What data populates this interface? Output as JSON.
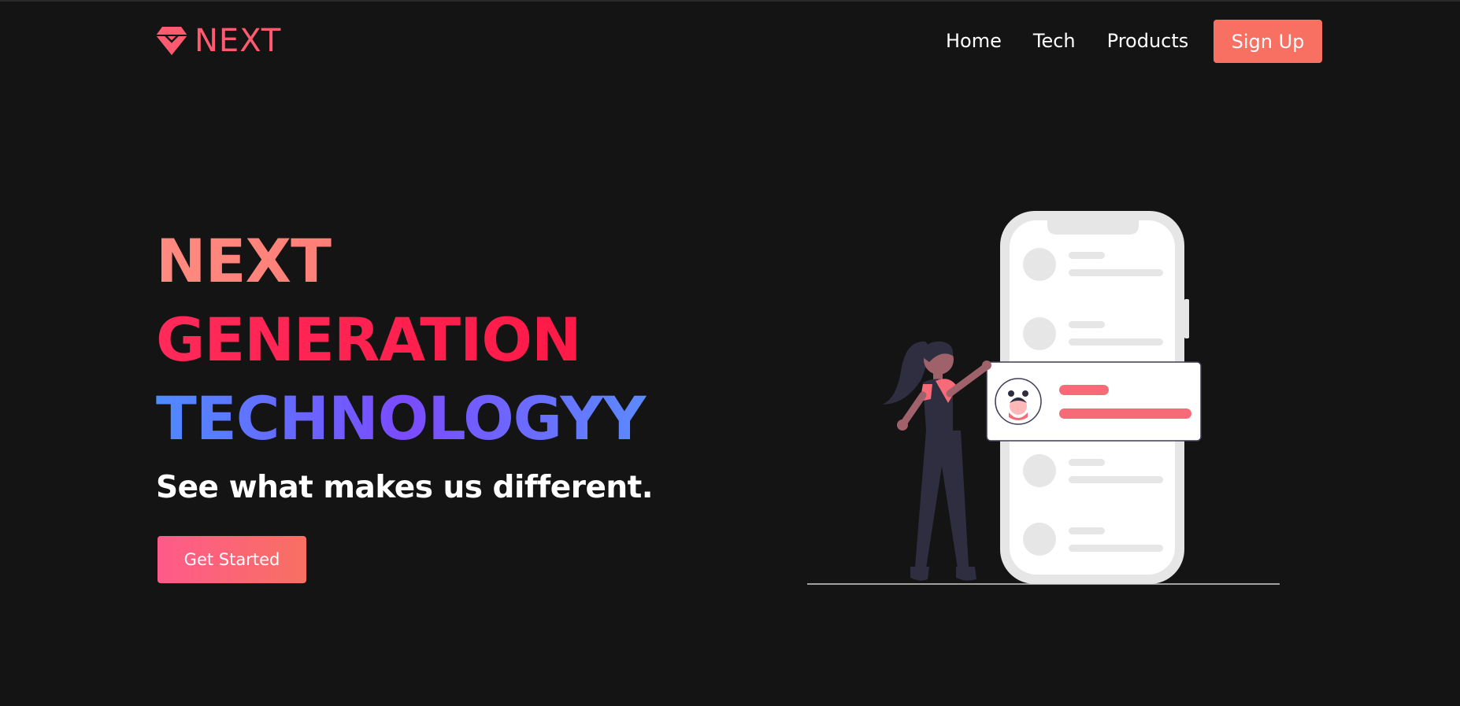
{
  "brand": {
    "name": "NEXT",
    "color": "#ff5a6f",
    "icon": "diamond-icon"
  },
  "nav": {
    "links": [
      "Home",
      "Tech",
      "Products"
    ],
    "signup_label": "Sign Up",
    "signup_color": "#f77062"
  },
  "hero": {
    "line1": "NEXT",
    "line2": "GENERATION",
    "line3": "TECHNOLOGYY",
    "subtitle": "See what makes us different.",
    "cta_label": "Get Started"
  },
  "illustration": {
    "icon": "person-with-phone-illustration"
  },
  "colors": {
    "background": "#141414",
    "accent": "#f77062",
    "line1_gradient": [
      "#ff8a80",
      "#ff6a6a"
    ],
    "line2_gradient": [
      "#ff2a5a",
      "#ff1744"
    ],
    "line3_gradient": [
      "#4f8bff",
      "#7b4bff"
    ]
  }
}
